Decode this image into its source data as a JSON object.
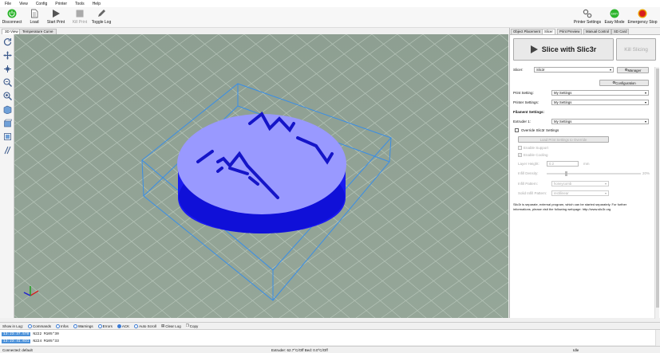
{
  "menu": [
    "File",
    "View",
    "Config",
    "Printer",
    "Tools",
    "Help"
  ],
  "toolbar": {
    "disconnect": "Disconnect",
    "load": "Load",
    "start_print": "Start Print",
    "kill_print": "Kill Print",
    "toggle_log": "Toggle Log",
    "printer_settings": "Printer Settings",
    "easy_mode": "Easy Mode",
    "easy_badge": "EASY",
    "emergency_stop": "Emergency Stop"
  },
  "left_tabs": [
    "3D View",
    "Temperature Curve"
  ],
  "right_tabs": [
    "Object Placement",
    "Slicer",
    "Print Preview",
    "Manual Control",
    "SD Card"
  ],
  "slicer": {
    "slice_button": "Slice with Slic3r",
    "kill_button": "Kill Slicing",
    "slicer_label": "Slicer:",
    "slicer_value": "Slic3r",
    "manager_button": "Manager",
    "configuration_button": "Configuration",
    "print_setting_label": "Print Setting:",
    "print_setting_value": "My Settings",
    "printer_settings_label": "Printer Settings:",
    "printer_settings_value": "My Settings",
    "filament_heading": "Filament Settings:",
    "extruder_label": "Extruder 1:",
    "extruder_value": "My Settings",
    "override_label": "Override Slic3r Settings",
    "load_button": "Load Print Settings to Override",
    "enable_support": "Enable Support",
    "enable_cooling": "Enable Cooling",
    "layer_height_label": "Layer Height:",
    "layer_height_value": "0.2",
    "layer_height_unit": "mm",
    "infill_density_label": "Infill Density:",
    "infill_density_value": "20%",
    "infill_density_fraction": 0.2,
    "infill_pattern_label": "Infill Pattern:",
    "infill_pattern_value": "honeycomb",
    "solid_infill_label": "Solid Infill Pattern:",
    "solid_infill_value": "rectilinear",
    "info_text_1": "Slic3r is separate, external program, which can be started separately. For further",
    "info_text_2": "informations, please visit the following webpage: http://www.slic3r.org"
  },
  "log_bar": {
    "show_in_log": "Show in Log:",
    "commands": "Commands",
    "infos": "Infos",
    "warnings": "Warnings",
    "errors": "Errors",
    "ack": "ACK",
    "auto_scroll": "Auto Scroll",
    "clear_log": "Clear Log",
    "copy": "Copy"
  },
  "log_lines": [
    {
      "time": "13:23:37.578",
      "text": "N222 M105*30"
    },
    {
      "time": "13:23:41.031",
      "text": "N224 M105*33"
    }
  ],
  "status": {
    "connection": "Connected: default",
    "temps": "Extruder: 62.7°C/Off Bed: 0.0°C/Off",
    "state": "Idle"
  },
  "colors": {
    "model_top": "#9999ff",
    "model_side": "#1a1af0",
    "bbox": "#3a8ee6",
    "floor": "#8fa294",
    "grid": "#b5c4b8"
  }
}
